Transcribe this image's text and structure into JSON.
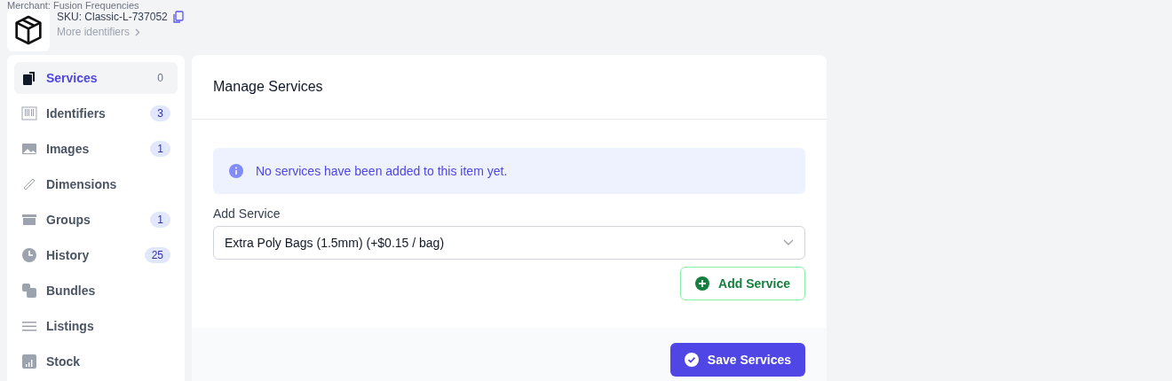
{
  "product": {
    "merchant": "Merchant: Fusion Frequencies",
    "sku": "SKU: Classic-L-737052",
    "more_link": "More identifiers"
  },
  "sidebar": {
    "items": [
      {
        "label": "Services",
        "count": "0",
        "selected": true
      },
      {
        "label": "Identifiers",
        "count": "3",
        "selected": false
      },
      {
        "label": "Images",
        "count": "1",
        "selected": false
      },
      {
        "label": "Dimensions",
        "selected": false
      },
      {
        "label": "Groups",
        "count": "1",
        "selected": false
      },
      {
        "label": "History",
        "count": "25",
        "selected": false
      },
      {
        "label": "Bundles",
        "selected": false
      },
      {
        "label": "Listings",
        "selected": false
      },
      {
        "label": "Stock",
        "selected": false
      }
    ]
  },
  "panel": {
    "title": "Manage Services",
    "notice": "No services have been added to this item yet.",
    "field_label": "Add Service",
    "select_value": "Extra Poly Bags (1.5mm) (+$0.15 / bag)",
    "add_button": "Add Service",
    "save_button": "Save Services"
  }
}
